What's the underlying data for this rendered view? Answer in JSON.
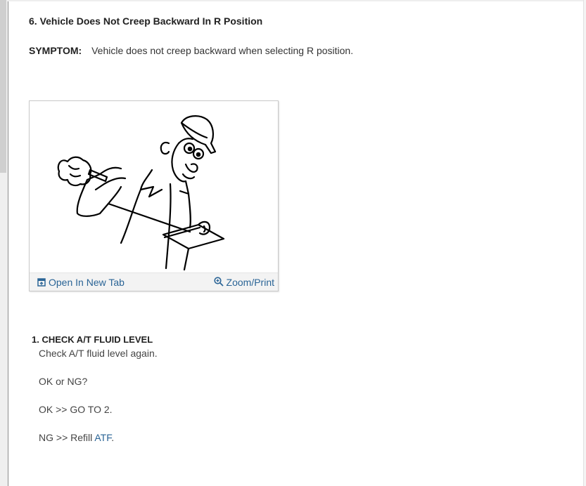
{
  "section": {
    "number": "6.",
    "title": "Vehicle Does Not Creep Backward In R Position"
  },
  "symptom": {
    "label": "SYMPTOM:",
    "text": "Vehicle does not creep backward when selecting R position."
  },
  "figure": {
    "illustration": "mechanic-with-clipboard",
    "open_label": "Open In New Tab",
    "zoom_label": "Zoom/Print"
  },
  "step1": {
    "heading": "1. CHECK A/T FLUID LEVEL",
    "instruction": "Check A/T fluid level again.",
    "question": "OK or NG?",
    "ok_result": "OK >> GO TO 2.",
    "ng_prefix": "NG >> Refill ",
    "ng_link": "ATF",
    "ng_suffix": "."
  },
  "colors": {
    "link": "#2a6496",
    "text": "#333333"
  }
}
